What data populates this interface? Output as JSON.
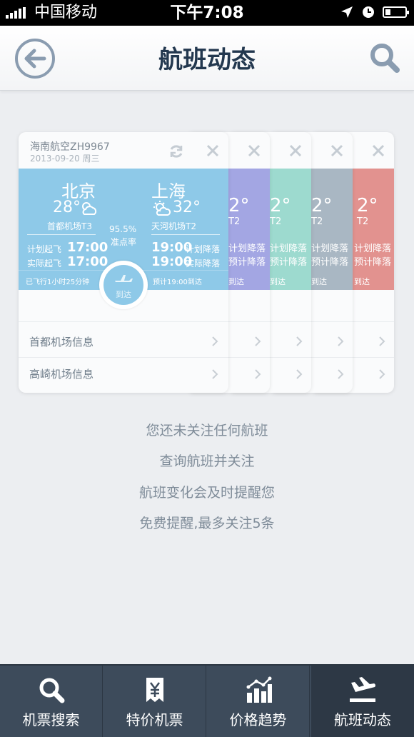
{
  "status_bar": {
    "carrier": "中国移动",
    "time": "下午7:08"
  },
  "nav": {
    "title": "航班动态",
    "back_icon": "back-arrow-icon",
    "search_icon": "search-icon"
  },
  "card": {
    "airline": "海南航空ZH9967",
    "date": "2013-09-20 周三",
    "departure": {
      "city": "北京",
      "temp": "28°",
      "airport": "首都机场T3",
      "planned_label": "计划起飞",
      "planned_time": "17:00",
      "actual_label": "实际起飞",
      "actual_time": "17:00"
    },
    "arrival": {
      "city": "上海",
      "temp": "32°",
      "airport": "天河机场T2",
      "planned_label": "计划降落",
      "planned_time": "19:00",
      "estimated_label": "实际降落",
      "estimated_time": "19:00"
    },
    "on_time_rate": "95.5%",
    "on_time_label": "准点率",
    "flown": "已飞行1小时25分钟",
    "eta": "预计19:00到达",
    "status": "到达",
    "departure_info": "首都机场信息",
    "arrival_info": "高崎机场信息"
  },
  "back_cards": [
    {
      "color": "#a3a6e3",
      "temp": "2°",
      "terminal": "T2",
      "planned": "计划降落",
      "estimated": "预计降落",
      "arrive": "到达"
    },
    {
      "color": "#9ddacf",
      "temp": "2°",
      "terminal": "T2",
      "planned": "计划降落",
      "estimated": "预计降落",
      "arrive": "到达"
    },
    {
      "color": "#a9b7c3",
      "temp": "2°",
      "terminal": "T2",
      "planned": "计划降落",
      "estimated": "预计降落",
      "arrive": "到达"
    },
    {
      "color": "#e2928f",
      "temp": "2°",
      "terminal": "T2",
      "planned": "计划降落",
      "estimated": "预计降落",
      "arrive": "到达"
    }
  ],
  "empty_state": [
    "您还未关注任何航班",
    "查询航班并关注",
    "航班变化会及时提醒您",
    "免费提醒,最多关注5条"
  ],
  "tabs": [
    {
      "label": "机票搜索",
      "icon": "search-icon"
    },
    {
      "label": "特价机票",
      "icon": "yuan-ticket-icon"
    },
    {
      "label": "价格趋势",
      "icon": "bar-chart-icon"
    },
    {
      "label": "航班动态",
      "icon": "landing-plane-icon",
      "active": true
    }
  ],
  "colors": {
    "accent": "#8ec9e8",
    "title": "#23384f",
    "tabbar": "#3d4b5b"
  }
}
